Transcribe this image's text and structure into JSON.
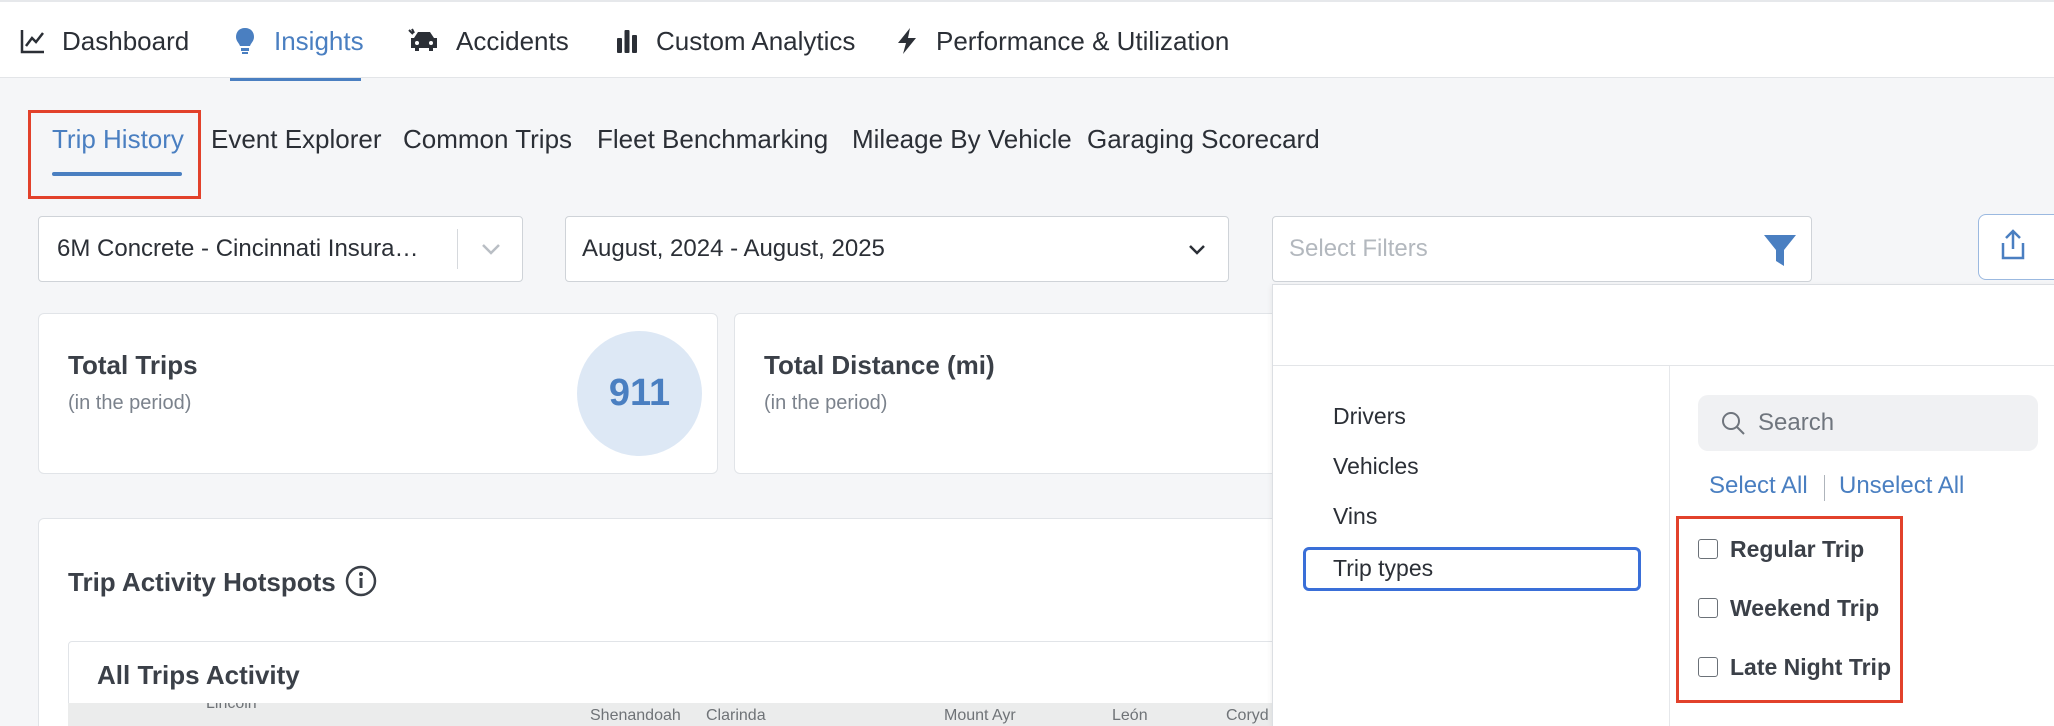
{
  "top_nav": {
    "items": [
      {
        "label": "Dashboard",
        "icon": "chart-line-icon"
      },
      {
        "label": "Insights",
        "icon": "lightbulb-icon",
        "active": true
      },
      {
        "label": "Accidents",
        "icon": "car-crash-icon"
      },
      {
        "label": "Custom Analytics",
        "icon": "bar-chart-icon"
      },
      {
        "label": "Performance & Utilization",
        "icon": "bolt-icon"
      }
    ]
  },
  "sub_tabs": [
    {
      "label": "Trip History",
      "active": true
    },
    {
      "label": "Event Explorer"
    },
    {
      "label": "Common Trips"
    },
    {
      "label": "Fleet Benchmarking"
    },
    {
      "label": "Mileage By Vehicle"
    },
    {
      "label": "Garaging Scorecard"
    }
  ],
  "filters": {
    "account_value": "6M Concrete - Cincinnati Insura…",
    "date_range_value": "August, 2024 - August, 2025",
    "filter_placeholder": "Select Filters"
  },
  "cards": {
    "total_trips": {
      "title": "Total Trips",
      "subtitle": "(in the period)",
      "value": "911"
    },
    "total_distance": {
      "title": "Total Distance (mi)",
      "subtitle": "(in the period)"
    }
  },
  "hotspots": {
    "title": "Trip Activity Hotspots",
    "panel_title": "All Trips Activity",
    "map_labels": [
      "Lincoln",
      "Shenandoah",
      "Clarinda",
      "Mount Ayr",
      "León",
      "Coryd"
    ]
  },
  "filter_panel": {
    "categories": [
      "Drivers",
      "Vehicles",
      "Vins",
      "Trip types"
    ],
    "selected_category": "Trip types",
    "search_placeholder": "Search",
    "select_all": "Select All",
    "unselect_all": "Unselect All",
    "options": [
      "Regular Trip",
      "Weekend Trip",
      "Late Night Trip"
    ]
  },
  "colors": {
    "accent": "#4a7fc1",
    "highlight": "#e2412b",
    "selected_border": "#3a6fd8"
  }
}
